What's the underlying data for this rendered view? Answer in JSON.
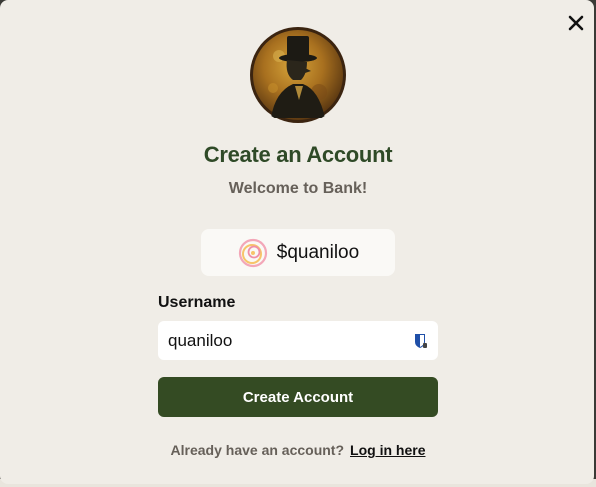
{
  "modal": {
    "close_icon": "close-icon",
    "avatar_icon": "top-hat-gentleman-portrait",
    "title": "Create an Account",
    "subtitle": "Welcome to Bank!",
    "handle": {
      "icon": "swirl-icon",
      "text": "$quaniloo"
    },
    "username_label": "Username",
    "username_value": "quaniloo",
    "username_field_icon": "password-manager-icon",
    "submit_label": "Create Account",
    "footer_text": "Already have an account?",
    "footer_link": "Log in here"
  },
  "colors": {
    "background": "#f0ede7",
    "title": "#2f4a27",
    "button": "#344b23",
    "muted": "#666059"
  }
}
